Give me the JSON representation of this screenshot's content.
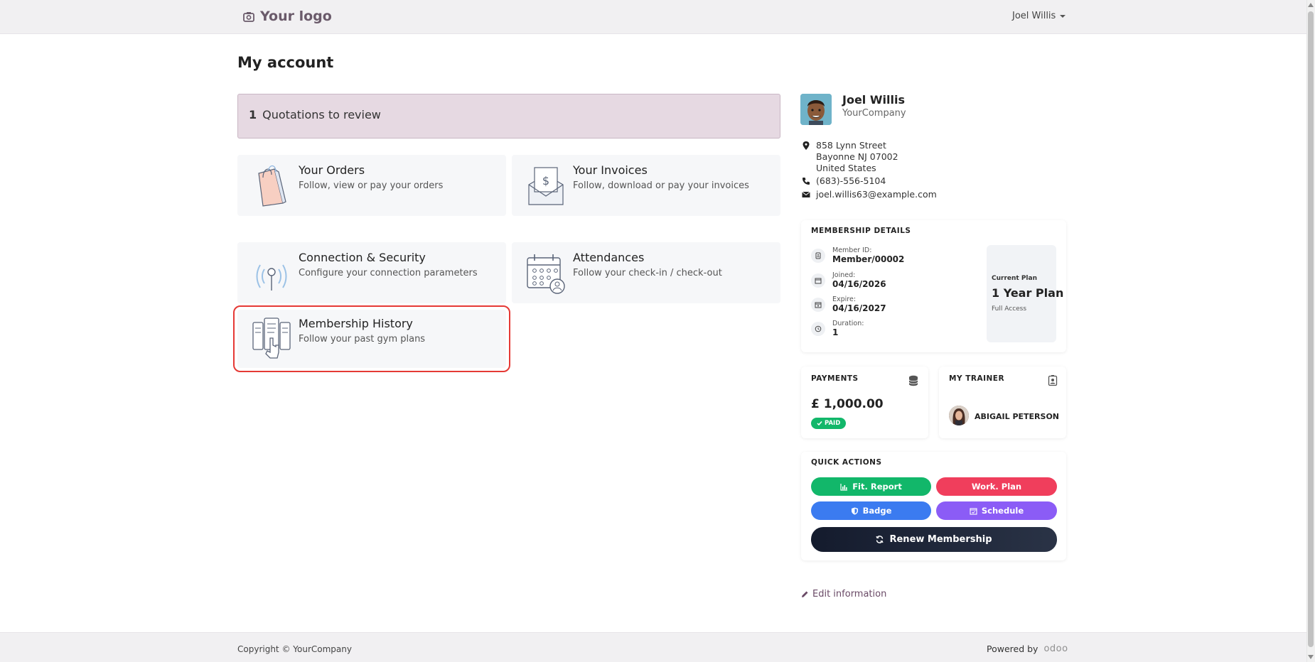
{
  "navbar": {
    "logo_text": "Your logo",
    "user_name": "Joel Willis"
  },
  "page": {
    "title": "My account"
  },
  "alert": {
    "count": "1",
    "text": "Quotations to review"
  },
  "cards": {
    "orders": {
      "title": "Your Orders",
      "subtitle": "Follow, view or pay your orders",
      "icon": "shopping-bag-icon"
    },
    "invoices": {
      "title": "Your Invoices",
      "subtitle": "Follow, download or pay your invoices",
      "icon": "invoice-envelope-icon"
    },
    "security": {
      "title": "Connection & Security",
      "subtitle": "Configure your connection parameters",
      "icon": "antenna-icon"
    },
    "attendances": {
      "title": "Attendances",
      "subtitle": "Follow your check-in / check-out",
      "icon": "calendar-person-icon"
    },
    "membership_history": {
      "title": "Membership History",
      "subtitle": "Follow your past gym plans",
      "icon": "document-hand-icon"
    }
  },
  "profile": {
    "name": "Joel Willis",
    "company": "YourCompany",
    "address_lines": [
      "858 Lynn Street",
      "Bayonne NJ 07002",
      "United States"
    ],
    "phone": "(683)-556-5104",
    "email": "joel.willis63@example.com"
  },
  "membership": {
    "title": "MEMBERSHIP DETAILS",
    "member_id_label": "Member ID:",
    "member_id": "Member/00002",
    "joined_label": "Joined:",
    "joined": "04/16/2026",
    "expire_label": "Expire:",
    "expire": "04/16/2027",
    "duration_label": "Duration:",
    "duration": "1",
    "plan_label": "Current Plan",
    "plan_name": "1 Year Plan",
    "plan_access": "Full Access"
  },
  "payments": {
    "title": "PAYMENTS",
    "amount": "£ 1,000.00",
    "status": "PAID"
  },
  "trainer": {
    "title": "MY TRAINER",
    "name": "ABIGAIL PETERSON"
  },
  "quick_actions": {
    "title": "QUICK ACTIONS",
    "fit_report": "Fit. Report",
    "work_plan": "Work. Plan",
    "badge": "Badge",
    "schedule": "Schedule",
    "renew": "Renew Membership"
  },
  "edit_link": "Edit information",
  "footer": {
    "copyright": "Copyright © YourCompany",
    "powered_by": "Powered by",
    "brand": "odoo"
  },
  "colors": {
    "fit_report": "#12b76a",
    "work_plan": "#f03e5c",
    "badge": "#3b7bf0",
    "schedule": "#8b5cf6",
    "alert_bg": "#e6d9e2",
    "selection_outline": "#e53935"
  }
}
